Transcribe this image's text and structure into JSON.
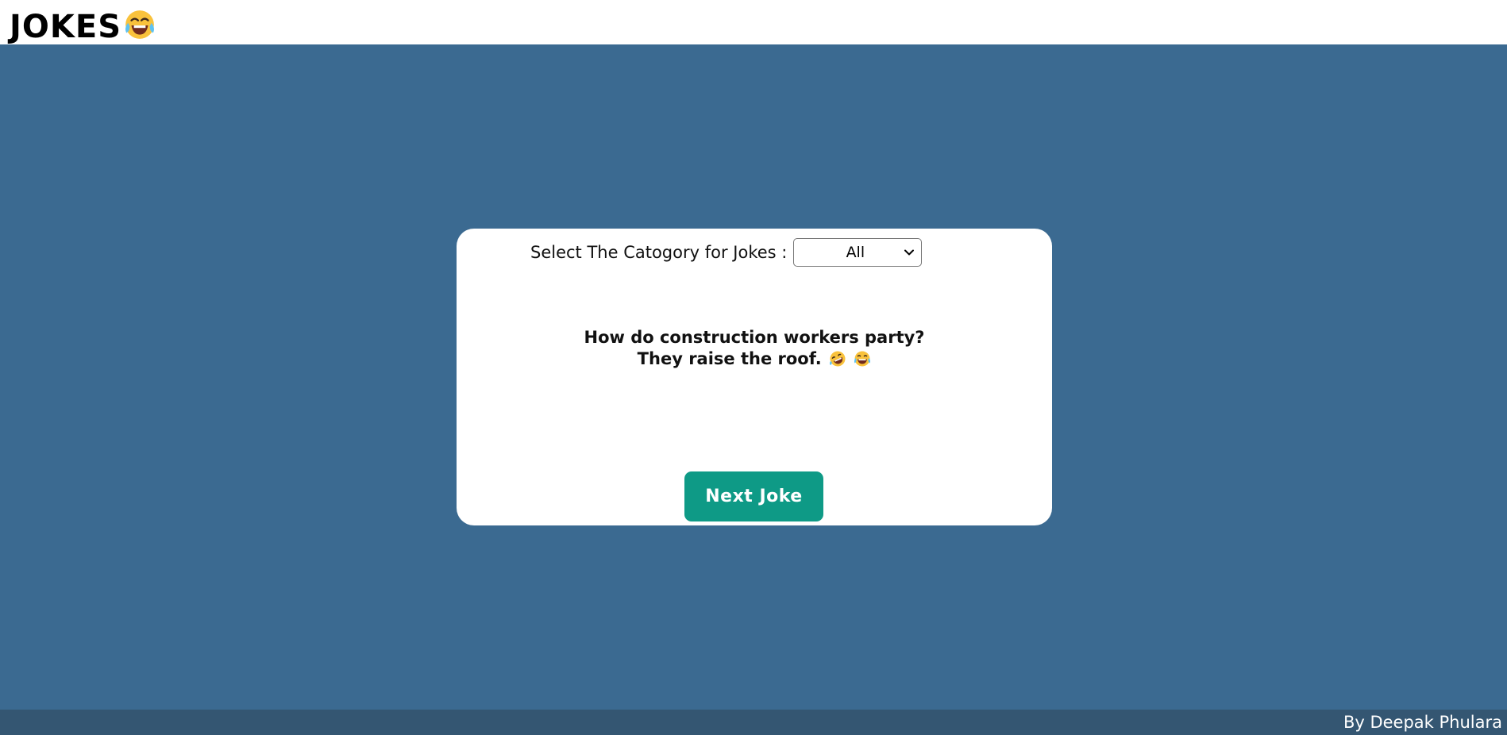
{
  "header": {
    "title": "JOKES",
    "title_icon": "laughing-tears-emoji"
  },
  "card": {
    "category_label": "Select The Catogory for Jokes :",
    "category_selected": "All",
    "joke_setup": "How do construction workers party?",
    "joke_punchline": "They raise the roof.",
    "joke_icons": [
      "rolling-laughing-emoji",
      "laughing-tears-emoji"
    ],
    "next_button_label": "Next Joke"
  },
  "footer": {
    "credit": "By Deepak Phulara"
  },
  "colors": {
    "background": "#3b6a91",
    "footer": "#345672",
    "button": "#0e9a86"
  }
}
